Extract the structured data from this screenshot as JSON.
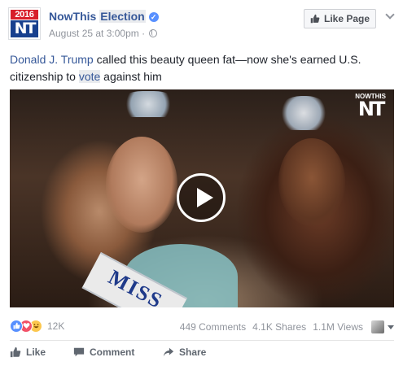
{
  "header": {
    "page_name": "NowThis",
    "page_name_highlight": "Election",
    "verified_mark": "✓",
    "date": "August 25 at 3:00pm",
    "separator": "·",
    "like_page_label": "Like Page",
    "avatar_year": "2016",
    "avatar_logo": "NT"
  },
  "post": {
    "text_link": "Donald J. Trump",
    "text_before_vote": " called this beauty queen fat—now she's earned U.S. citizenship to ",
    "text_vote": "vote",
    "text_after_vote": " against him"
  },
  "video": {
    "watermark_top": "NOWTHIS",
    "watermark_logo": "NT",
    "sash_text": "MISS"
  },
  "stats": {
    "reaction_count": "12K",
    "comments": "449 Comments",
    "shares": "4.1K Shares",
    "views": "1.1M Views"
  },
  "actions": {
    "like": "Like",
    "comment": "Comment",
    "share": "Share"
  },
  "colors": {
    "link": "#365899",
    "like_reaction": "#5890ff",
    "love_reaction": "#f25268",
    "haha_reaction": "#fcc74e"
  }
}
